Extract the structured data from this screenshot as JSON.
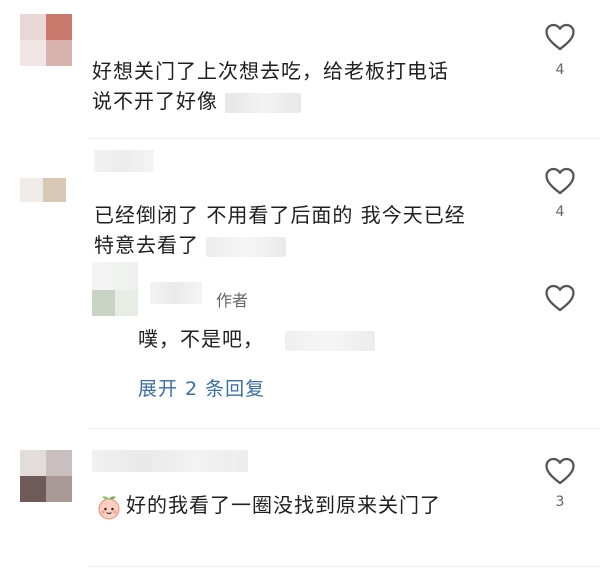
{
  "comments": [
    {
      "text_line1": "好想关门了上次想去吃，给老板打电话",
      "text_line2": "说不开了好像",
      "likes": "4"
    },
    {
      "text_line1": "已经倒闭了 不用看了后面的 我今天已经",
      "text_line2": "特意去看了",
      "likes": "4",
      "reply": {
        "author_badge": "作者",
        "text": "噗，不是吧，",
        "expand_label": "展开 2 条回复"
      }
    },
    {
      "text": "好的我看了一圈没找到原来关门了",
      "likes": "3"
    }
  ],
  "colors": {
    "link": "#3a6ea5",
    "text": "#1f1f1f",
    "muted": "#666666",
    "divider": "#ececec"
  },
  "icons": [
    "heart-outline-icon",
    "peach-emoji-icon"
  ]
}
